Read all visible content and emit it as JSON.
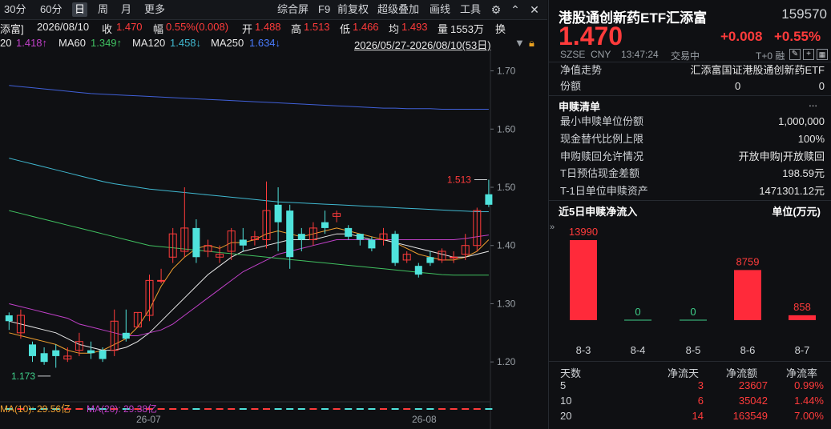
{
  "toolbar": {
    "items": [
      "30分",
      "60分",
      "日",
      "周",
      "月",
      "更多",
      "综合屏",
      "F9",
      "前复权",
      "超级叠加",
      "画线",
      "工具"
    ],
    "active": "日",
    "icons": [
      "gear-icon",
      "chevron-up-icon",
      "close-icon"
    ]
  },
  "info": {
    "name_fragment": "添富]",
    "date": "2026/08/10",
    "close_label": "收",
    "close": "1.470",
    "change_label": "幅",
    "change": "0.55%(0.008)",
    "open_label": "开",
    "open": "1.488",
    "high_label": "高",
    "high": "1.513",
    "low_label": "低",
    "low": "1.466",
    "avg_label": "均",
    "avg": "1.493",
    "vol_label": "量",
    "vol": "1553万",
    "turn_label": "换"
  },
  "ma": {
    "ma20_label": "20",
    "ma20": "1.418↑",
    "ma60_label": "MA60",
    "ma60": "1.349↑",
    "ma120_label": "MA120",
    "ma120": "1.458↓",
    "ma250_label": "MA250",
    "ma250": "1.634↓",
    "range": "2026/05/27-2026/08/10(53日)"
  },
  "chart_data": {
    "type": "candlestick",
    "y_ticks": [
      "1.70",
      "1.60",
      "1.50",
      "1.40",
      "1.30",
      "1.20"
    ],
    "ylim": [
      1.17,
      1.72
    ],
    "x_ticks": [
      "26-07",
      "26-08"
    ],
    "annotations": {
      "high": "1.513",
      "low": "1.173"
    },
    "candles": [
      {
        "o": 1.28,
        "c": 1.27,
        "h": 1.285,
        "l": 1.255
      },
      {
        "o": 1.25,
        "c": 1.28,
        "h": 1.29,
        "l": 1.24
      },
      {
        "o": 1.23,
        "c": 1.21,
        "h": 1.235,
        "l": 1.2
      },
      {
        "o": 1.215,
        "c": 1.2,
        "h": 1.225,
        "l": 1.195
      },
      {
        "o": 1.22,
        "c": 1.21,
        "h": 1.23,
        "l": 1.19
      },
      {
        "o": 1.205,
        "c": 1.21,
        "h": 1.225,
        "l": 1.2
      },
      {
        "o": 1.22,
        "c": 1.235,
        "h": 1.25,
        "l": 1.21
      },
      {
        "o": 1.22,
        "c": 1.215,
        "h": 1.235,
        "l": 1.205
      },
      {
        "o": 1.22,
        "c": 1.205,
        "h": 1.225,
        "l": 1.2
      },
      {
        "o": 1.22,
        "c": 1.27,
        "h": 1.29,
        "l": 1.21
      },
      {
        "o": 1.25,
        "c": 1.24,
        "h": 1.29,
        "l": 1.235
      },
      {
        "o": 1.26,
        "c": 1.285,
        "h": 1.285,
        "l": 1.26
      },
      {
        "o": 1.28,
        "c": 1.34,
        "h": 1.35,
        "l": 1.27
      },
      {
        "o": 1.34,
        "c": 1.34,
        "h": 1.36,
        "l": 1.335
      },
      {
        "o": 1.38,
        "c": 1.42,
        "h": 1.43,
        "l": 1.37
      },
      {
        "o": 1.39,
        "c": 1.43,
        "h": 1.5,
        "l": 1.38
      },
      {
        "o": 1.43,
        "c": 1.38,
        "h": 1.445,
        "l": 1.37
      },
      {
        "o": 1.39,
        "c": 1.4,
        "h": 1.41,
        "l": 1.38
      },
      {
        "o": 1.38,
        "c": 1.385,
        "h": 1.4,
        "l": 1.37
      },
      {
        "o": 1.39,
        "c": 1.425,
        "h": 1.43,
        "l": 1.375
      },
      {
        "o": 1.41,
        "c": 1.4,
        "h": 1.43,
        "l": 1.39
      },
      {
        "o": 1.41,
        "c": 1.415,
        "h": 1.425,
        "l": 1.4
      },
      {
        "o": 1.41,
        "c": 1.46,
        "h": 1.51,
        "l": 1.395
      },
      {
        "o": 1.47,
        "c": 1.44,
        "h": 1.5,
        "l": 1.39
      },
      {
        "o": 1.46,
        "c": 1.38,
        "h": 1.47,
        "l": 1.36
      },
      {
        "o": 1.42,
        "c": 1.41,
        "h": 1.43,
        "l": 1.39
      },
      {
        "o": 1.41,
        "c": 1.43,
        "h": 1.44,
        "l": 1.4
      },
      {
        "o": 1.44,
        "c": 1.43,
        "h": 1.46,
        "l": 1.42
      },
      {
        "o": 1.45,
        "c": 1.455,
        "h": 1.46,
        "l": 1.44
      },
      {
        "o": 1.43,
        "c": 1.415,
        "h": 1.435,
        "l": 1.41
      },
      {
        "o": 1.42,
        "c": 1.41,
        "h": 1.42,
        "l": 1.4
      },
      {
        "o": 1.41,
        "c": 1.395,
        "h": 1.415,
        "l": 1.39
      },
      {
        "o": 1.41,
        "c": 1.42,
        "h": 1.43,
        "l": 1.4
      },
      {
        "o": 1.42,
        "c": 1.37,
        "h": 1.425,
        "l": 1.365
      },
      {
        "o": 1.375,
        "c": 1.385,
        "h": 1.39,
        "l": 1.37
      },
      {
        "o": 1.365,
        "c": 1.35,
        "h": 1.37,
        "l": 1.345
      },
      {
        "o": 1.38,
        "c": 1.37,
        "h": 1.39,
        "l": 1.365
      },
      {
        "o": 1.375,
        "c": 1.39,
        "h": 1.395,
        "l": 1.37
      },
      {
        "o": 1.38,
        "c": 1.38,
        "h": 1.39,
        "l": 1.37
      },
      {
        "o": 1.385,
        "c": 1.4,
        "h": 1.42,
        "l": 1.375
      },
      {
        "o": 1.4,
        "c": 1.46,
        "h": 1.465,
        "l": 1.39
      },
      {
        "o": 1.488,
        "c": 1.47,
        "h": 1.513,
        "l": 1.466
      }
    ],
    "ma_lines": [
      {
        "name": "MA5",
        "color": "#f0a030",
        "values": [
          1.25,
          1.245,
          1.24,
          1.235,
          1.23,
          1.22,
          1.215,
          1.215,
          1.22,
          1.23,
          1.24,
          1.26,
          1.29,
          1.33,
          1.36,
          1.38,
          1.395,
          1.4,
          1.395,
          1.405,
          1.405,
          1.41,
          1.42,
          1.425,
          1.42,
          1.415,
          1.42,
          1.425,
          1.43,
          1.425,
          1.42,
          1.415,
          1.41,
          1.405,
          1.395,
          1.385,
          1.38,
          1.375,
          1.375,
          1.38,
          1.39,
          1.41
        ]
      },
      {
        "name": "MA10",
        "color": "#e8e8e8",
        "values": [
          1.27,
          1.265,
          1.26,
          1.255,
          1.25,
          1.24,
          1.23,
          1.225,
          1.22,
          1.22,
          1.225,
          1.235,
          1.25,
          1.27,
          1.29,
          1.31,
          1.33,
          1.35,
          1.365,
          1.38,
          1.39,
          1.395,
          1.4,
          1.405,
          1.41,
          1.41,
          1.41,
          1.415,
          1.42,
          1.42,
          1.415,
          1.41,
          1.41,
          1.405,
          1.4,
          1.395,
          1.39,
          1.385,
          1.38,
          1.38,
          1.385,
          1.39
        ]
      },
      {
        "name": "MA20",
        "color": "#c040c8",
        "values": [
          1.3,
          1.295,
          1.29,
          1.285,
          1.28,
          1.275,
          1.265,
          1.26,
          1.255,
          1.25,
          1.245,
          1.245,
          1.25,
          1.255,
          1.265,
          1.28,
          1.295,
          1.31,
          1.325,
          1.34,
          1.355,
          1.365,
          1.375,
          1.385,
          1.39,
          1.395,
          1.4,
          1.405,
          1.41,
          1.41,
          1.41,
          1.41,
          1.41,
          1.41,
          1.41,
          1.41,
          1.41,
          1.41,
          1.41,
          1.412,
          1.415,
          1.418
        ]
      },
      {
        "name": "MA60",
        "color": "#40c060",
        "values": [
          1.46,
          1.455,
          1.45,
          1.445,
          1.44,
          1.435,
          1.43,
          1.425,
          1.42,
          1.415,
          1.41,
          1.405,
          1.4,
          1.398,
          1.396,
          1.394,
          1.392,
          1.39,
          1.388,
          1.386,
          1.384,
          1.382,
          1.38,
          1.378,
          1.376,
          1.374,
          1.372,
          1.37,
          1.368,
          1.366,
          1.364,
          1.362,
          1.36,
          1.358,
          1.356,
          1.354,
          1.352,
          1.35,
          1.349,
          1.349,
          1.349,
          1.349
        ]
      },
      {
        "name": "MA120",
        "color": "#40b8d0",
        "values": [
          1.55,
          1.545,
          1.54,
          1.535,
          1.53,
          1.525,
          1.52,
          1.515,
          1.51,
          1.506,
          1.503,
          1.5,
          1.497,
          1.495,
          1.493,
          1.491,
          1.489,
          1.487,
          1.485,
          1.483,
          1.481,
          1.479,
          1.477,
          1.475,
          1.474,
          1.473,
          1.472,
          1.471,
          1.47,
          1.469,
          1.468,
          1.467,
          1.466,
          1.465,
          1.464,
          1.463,
          1.462,
          1.461,
          1.46,
          1.459,
          1.458,
          1.458
        ]
      },
      {
        "name": "MA250",
        "color": "#4060d8",
        "values": [
          1.675,
          1.673,
          1.671,
          1.669,
          1.667,
          1.665,
          1.663,
          1.661,
          1.66,
          1.659,
          1.658,
          1.657,
          1.656,
          1.655,
          1.654,
          1.653,
          1.652,
          1.651,
          1.65,
          1.649,
          1.648,
          1.647,
          1.646,
          1.645,
          1.644,
          1.643,
          1.642,
          1.641,
          1.64,
          1.639,
          1.638,
          1.637,
          1.636,
          1.636,
          1.635,
          1.635,
          1.635,
          1.634,
          1.634,
          1.634,
          1.634,
          1.634
        ]
      }
    ]
  },
  "volume": {
    "ma10": "MA(10): 29.56亿",
    "ma20": "MA(20): 29.38亿"
  },
  "quote": {
    "title": "港股通创新药ETF汇添富",
    "code": "159570",
    "price": "1.470",
    "change": "+0.008",
    "change_pct": "+0.55%",
    "market": "SZSE",
    "currency": "CNY",
    "time": "13:47:24",
    "status": "交易中",
    "tplus": "T+0 融"
  },
  "nav": {
    "label": "净值走势",
    "fund": "汇添富国证港股通创新药ETF",
    "share_label": "份额",
    "v1": "0",
    "v2": "0"
  },
  "subscription": {
    "title": "申赎清单",
    "more": "...",
    "rows": [
      {
        "k": "最小申赎单位份额",
        "v": "1,000,000"
      },
      {
        "k": "现金替代比例上限",
        "v": "100%"
      },
      {
        "k": "申购赎回允许情况",
        "v": "开放申购|开放赎回"
      },
      {
        "k": "T日预估现金差额",
        "v": "198.59元"
      },
      {
        "k": "T-1日单位申赎资产",
        "v": "1471301.12元"
      }
    ]
  },
  "inflow": {
    "title": "近5日申赎净流入",
    "unit": "单位(万元)",
    "chart_data": {
      "type": "bar",
      "categories": [
        "8-3",
        "8-4",
        "8-5",
        "8-6",
        "8-7"
      ],
      "values": [
        13990,
        0,
        0,
        8759,
        858
      ],
      "labels": [
        "13990",
        "0",
        "0",
        "8759",
        "858"
      ]
    }
  },
  "table": {
    "headers": [
      "天数",
      "净流天",
      "净流额",
      "净流率"
    ],
    "rows": [
      [
        "5",
        "3",
        "23607",
        "0.99%"
      ],
      [
        "10",
        "6",
        "35042",
        "1.44%"
      ],
      [
        "20",
        "14",
        "163549",
        "7.00%"
      ]
    ]
  },
  "colors": {
    "up": "#ff3b3b",
    "down": "#4fe3dc",
    "bg": "#0f1013"
  }
}
